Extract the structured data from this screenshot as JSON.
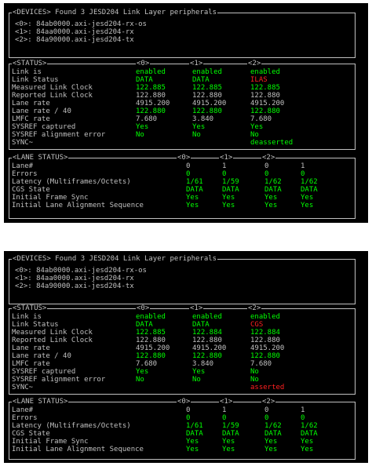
{
  "terminals": [
    {
      "devices": {
        "title": "<DEVICES> Found 3 JESD204 Link Layer peripherals",
        "lines": [
          "<0>: 84ab0000.axi-jesd204-rx-os",
          "<1>: 84aa0000.axi-jesd204-rx",
          "<2>: 84a90000.axi-jesd204-tx"
        ]
      },
      "status": {
        "title": "<STATUS>",
        "cols": [
          "<0>",
          "<1>",
          "<2>"
        ],
        "labels": [
          "Link is",
          "Link Status",
          "Measured Link Clock",
          "Reported Link Clock",
          "Lane rate",
          "Lane rate / 40",
          "LMFC rate",
          "SYSREF captured",
          "SYSREF alignment error",
          "SYNC~"
        ],
        "values": [
          [
            "enabled",
            "enabled",
            "enabled"
          ],
          [
            "DATA",
            "DATA",
            "ILAS"
          ],
          [
            "122.885",
            "122.885",
            "122.885"
          ],
          [
            "122.880",
            "122.880",
            "122.880"
          ],
          [
            "4915.200",
            "4915.200",
            "4915.200"
          ],
          [
            "122.880",
            "122.880",
            "122.880"
          ],
          [
            "7.680",
            "3.840",
            "7.680"
          ],
          [
            "Yes",
            "Yes",
            "Yes"
          ],
          [
            "No",
            "No",
            "No"
          ],
          [
            "",
            "",
            "deasserted"
          ]
        ],
        "colors": [
          [
            "g",
            "g",
            "g"
          ],
          [
            "g",
            "g",
            "r"
          ],
          [
            "g",
            "g",
            "g"
          ],
          [
            "w",
            "w",
            "w"
          ],
          [
            "w",
            "w",
            "w"
          ],
          [
            "g",
            "g",
            "g"
          ],
          [
            "w",
            "w",
            "w"
          ],
          [
            "g",
            "g",
            "g"
          ],
          [
            "g",
            "g",
            "g"
          ],
          [
            "w",
            "w",
            "g"
          ]
        ]
      },
      "lanes": {
        "title": "<LANE STATUS>",
        "cols": [
          "<0>",
          "<1>",
          "<2>"
        ],
        "labels": [
          "Lane#",
          "Errors",
          "Latency (Multiframes/Octets)",
          "CGS State",
          "Initial Frame Sync",
          "Initial Lane Alignment Sequence"
        ],
        "values": [
          [
            "0",
            "1",
            "0",
            "1"
          ],
          [
            "0",
            "0",
            "0",
            "0"
          ],
          [
            "1/61",
            "1/59",
            "1/62",
            "1/62"
          ],
          [
            "DATA",
            "DATA",
            "DATA",
            "DATA"
          ],
          [
            "Yes",
            "Yes",
            "Yes",
            "Yes"
          ],
          [
            "Yes",
            "Yes",
            "Yes",
            "Yes"
          ]
        ],
        "colors": [
          [
            "w",
            "w",
            "w",
            "w"
          ],
          [
            "g",
            "g",
            "g",
            "g"
          ],
          [
            "g",
            "g",
            "g",
            "g"
          ],
          [
            "g",
            "g",
            "g",
            "g"
          ],
          [
            "g",
            "g",
            "g",
            "g"
          ],
          [
            "g",
            "g",
            "g",
            "g"
          ]
        ]
      }
    },
    {
      "devices": {
        "title": "<DEVICES> Found 3 JESD204 Link Layer peripherals",
        "lines": [
          "<0>: 84ab0000.axi-jesd204-rx-os",
          "<1>: 84aa0000.axi-jesd204-rx",
          "<2>: 84a90000.axi-jesd204-tx"
        ]
      },
      "status": {
        "title": "<STATUS>",
        "cols": [
          "<0>",
          "<1>",
          "<2>"
        ],
        "labels": [
          "Link is",
          "Link Status",
          "Measured Link Clock",
          "Reported Link Clock",
          "Lane rate",
          "Lane rate / 40",
          "LMFC rate",
          "SYSREF captured",
          "SYSREF alignment error",
          "SYNC~"
        ],
        "values": [
          [
            "enabled",
            "enabled",
            "enabled"
          ],
          [
            "DATA",
            "DATA",
            "CGS"
          ],
          [
            "122.885",
            "122.884",
            "122.884"
          ],
          [
            "122.880",
            "122.880",
            "122.880"
          ],
          [
            "4915.200",
            "4915.200",
            "4915.200"
          ],
          [
            "122.880",
            "122.880",
            "122.880"
          ],
          [
            "7.680",
            "3.840",
            "7.680"
          ],
          [
            "Yes",
            "Yes",
            "No"
          ],
          [
            "No",
            "No",
            "No"
          ],
          [
            "",
            "",
            "asserted"
          ]
        ],
        "colors": [
          [
            "g",
            "g",
            "g"
          ],
          [
            "g",
            "g",
            "r"
          ],
          [
            "g",
            "g",
            "g"
          ],
          [
            "w",
            "w",
            "w"
          ],
          [
            "w",
            "w",
            "w"
          ],
          [
            "g",
            "g",
            "g"
          ],
          [
            "w",
            "w",
            "w"
          ],
          [
            "g",
            "g",
            "g"
          ],
          [
            "g",
            "g",
            "g"
          ],
          [
            "w",
            "w",
            "r"
          ]
        ]
      },
      "lanes": {
        "title": "<LANE STATUS>",
        "cols": [
          "<0>",
          "<1>",
          "<2>"
        ],
        "labels": [
          "Lane#",
          "Errors",
          "Latency (Multiframes/Octets)",
          "CGS State",
          "Initial Frame Sync",
          "Initial Lane Alignment Sequence"
        ],
        "values": [
          [
            "0",
            "1",
            "0",
            "1"
          ],
          [
            "0",
            "0",
            "0",
            "0"
          ],
          [
            "1/61",
            "1/59",
            "1/62",
            "1/62"
          ],
          [
            "DATA",
            "DATA",
            "DATA",
            "DATA"
          ],
          [
            "Yes",
            "Yes",
            "Yes",
            "Yes"
          ],
          [
            "Yes",
            "Yes",
            "Yes",
            "Yes"
          ]
        ],
        "colors": [
          [
            "w",
            "w",
            "w",
            "w"
          ],
          [
            "g",
            "g",
            "g",
            "g"
          ],
          [
            "g",
            "g",
            "g",
            "g"
          ],
          [
            "g",
            "g",
            "g",
            "g"
          ],
          [
            "g",
            "g",
            "g",
            "g"
          ],
          [
            "g",
            "g",
            "g",
            "g"
          ]
        ]
      }
    }
  ],
  "colors": {
    "background": "#000000",
    "text": "#c0c0c0",
    "ok": "#00ff00",
    "error": "#ff2020"
  }
}
